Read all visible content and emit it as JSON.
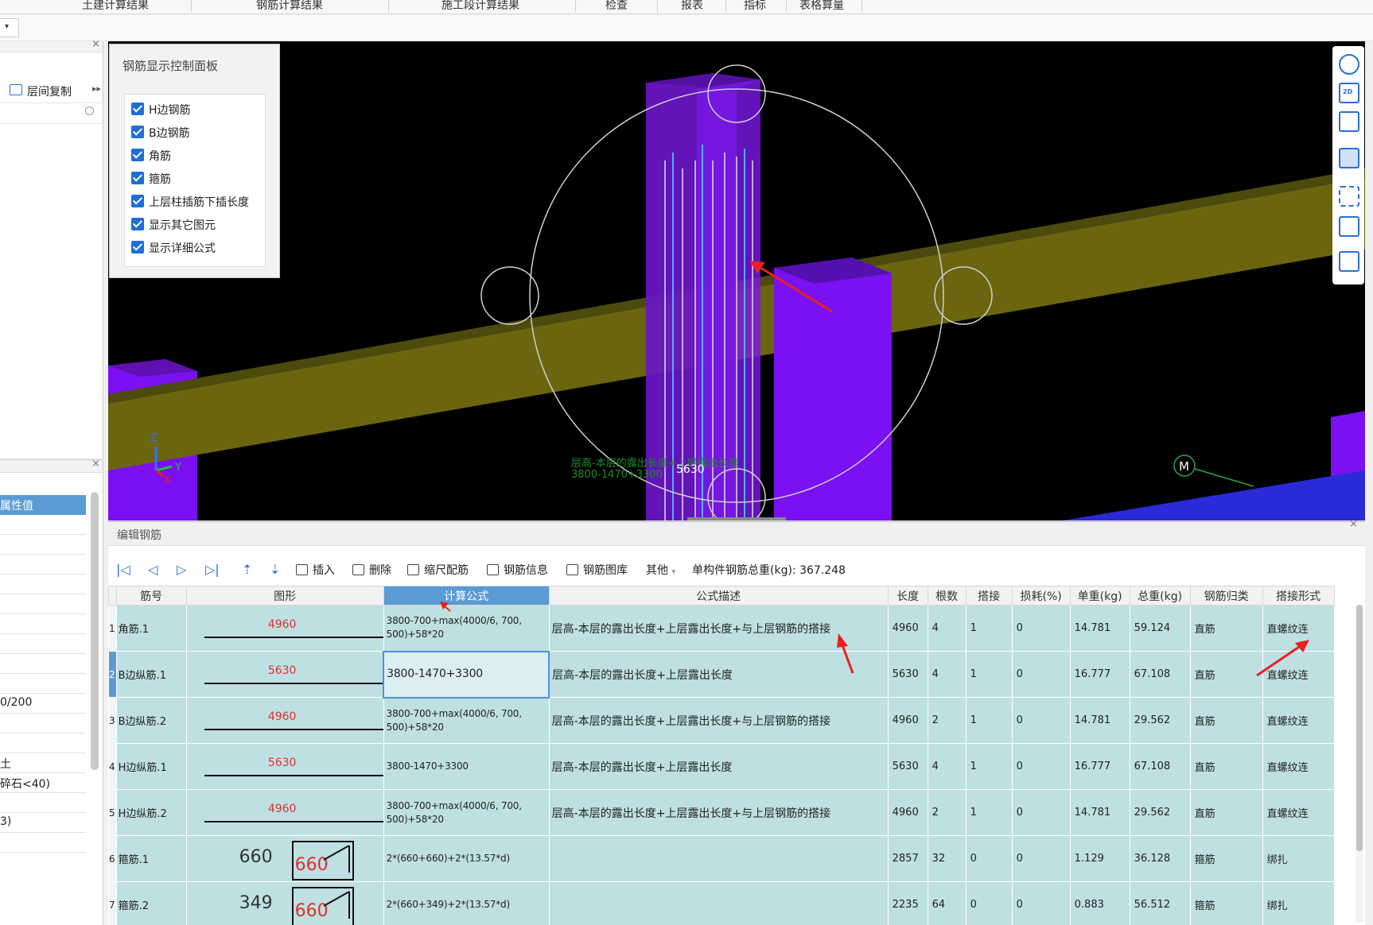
{
  "top_tabs": [
    "土建计算结果",
    "钢筋计算结果",
    "施工段计算结果",
    "检查",
    "报表",
    "指标",
    "表格算量"
  ],
  "left_panel": {
    "copy_label": "层间复制",
    "prop_header": "属性值",
    "rows": [
      "",
      "",
      "",
      "",
      "",
      "",
      "",
      "",
      "",
      "0/200",
      "",
      "",
      "土",
      "碎石<40)",
      "",
      "3)",
      ""
    ]
  },
  "control_panel": {
    "title": "钢筋显示控制面板",
    "options": [
      {
        "label": "H边钢筋",
        "checked": true
      },
      {
        "label": "B边钢筋",
        "checked": true
      },
      {
        "label": "角筋",
        "checked": true
      },
      {
        "label": "箍筋",
        "checked": true
      },
      {
        "label": "上层柱插筋下插长度",
        "checked": true
      },
      {
        "label": "显示其它图元",
        "checked": true
      },
      {
        "label": "显示详细公式",
        "checked": true
      }
    ]
  },
  "viewport": {
    "overlay_text_1": "层高-本层的露出长度+上层露出长度",
    "overlay_text_2": "3800-1470+3300",
    "dimension": "5630",
    "axis_z": "Z",
    "axis_y": "Y",
    "axis_x": "X",
    "marker": "M",
    "right_tools": [
      "orbit-icon",
      "2d-view-icon",
      "cube-icon",
      "cube-solid-icon",
      "fullscreen-icon",
      "component-icon",
      "report-view-icon"
    ],
    "right_tool_2d_label": "2D"
  },
  "editor": {
    "title": "编辑钢筋",
    "toolbar": {
      "insert": "插入",
      "delete": "删除",
      "scale_rebar": "缩尺配筋",
      "rebar_info": "钢筋信息",
      "rebar_library": "钢筋图库",
      "other": "其他",
      "total_weight": "单构件钢筋总重(kg): 367.248"
    },
    "columns": [
      "筋号",
      "图形",
      "计算公式",
      "公式描述",
      "长度",
      "根数",
      "搭接",
      "损耗(%)",
      "单重(kg)",
      "总重(kg)",
      "钢筋归类",
      "搭接形式"
    ],
    "rows": [
      {
        "idx": "1",
        "name": "角筋.1",
        "shape": "4960",
        "shape_type": "line",
        "formula": "3800-700+max(4000/6, 700, 500)+58*20",
        "desc": "层高-本层的露出长度+上层露出长度+与上层钢筋的搭接",
        "length": "4960",
        "count": "4",
        "lap": "1",
        "loss": "0",
        "unit_w": "14.781",
        "total_w": "59.124",
        "category": "直筋",
        "lap_type": "直螺纹连"
      },
      {
        "idx": "2",
        "name": "B边纵筋.1",
        "shape": "5630",
        "shape_type": "line",
        "formula": "3800-1470+3300",
        "desc": "层高-本层的露出长度+上层露出长度",
        "length": "5630",
        "count": "4",
        "lap": "1",
        "loss": "0",
        "unit_w": "16.777",
        "total_w": "67.108",
        "category": "直筋",
        "lap_type": "直螺纹连"
      },
      {
        "idx": "3",
        "name": "B边纵筋.2",
        "shape": "4960",
        "shape_type": "line",
        "formula": "3800-700+max(4000/6, 700, 500)+58*20",
        "desc": "层高-本层的露出长度+上层露出长度+与上层钢筋的搭接",
        "length": "4960",
        "count": "2",
        "lap": "1",
        "loss": "0",
        "unit_w": "14.781",
        "total_w": "29.562",
        "category": "直筋",
        "lap_type": "直螺纹连"
      },
      {
        "idx": "4",
        "name": "H边纵筋.1",
        "shape": "5630",
        "shape_type": "line",
        "formula": "3800-1470+3300",
        "desc": "层高-本层的露出长度+上层露出长度",
        "length": "5630",
        "count": "4",
        "lap": "1",
        "loss": "0",
        "unit_w": "16.777",
        "total_w": "67.108",
        "category": "直筋",
        "lap_type": "直螺纹连"
      },
      {
        "idx": "5",
        "name": "H边纵筋.2",
        "shape": "4960",
        "shape_type": "line",
        "formula": "3800-700+max(4000/6, 700, 500)+58*20",
        "desc": "层高-本层的露出长度+上层露出长度+与上层钢筋的搭接",
        "length": "4960",
        "count": "2",
        "lap": "1",
        "loss": "0",
        "unit_w": "14.781",
        "total_w": "29.562",
        "category": "直筋",
        "lap_type": "直螺纹连"
      },
      {
        "idx": "6",
        "name": "箍筋.1",
        "shape_w": "660",
        "shape_h": "660",
        "shape_type": "stirrup",
        "formula": "2*(660+660)+2*(13.57*d)",
        "desc": "",
        "length": "2857",
        "count": "32",
        "lap": "0",
        "loss": "0",
        "unit_w": "1.129",
        "total_w": "36.128",
        "category": "箍筋",
        "lap_type": "绑扎"
      },
      {
        "idx": "7",
        "name": "箍筋.2",
        "shape_w": "349",
        "shape_h": "660",
        "shape_type": "stirrup",
        "formula": "2*(660+349)+2*(13.57*d)",
        "desc": "",
        "length": "2235",
        "count": "64",
        "lap": "0",
        "loss": "0",
        "unit_w": "0.883",
        "total_w": "56.512",
        "category": "箍筋",
        "lap_type": "绑扎"
      }
    ]
  },
  "colors": {
    "column": "#7b10f2",
    "beam": "#6b6510",
    "accent": "#5b9bd5",
    "grid_row": "#bfe0e2",
    "annotation_arrow": "#e82020"
  }
}
